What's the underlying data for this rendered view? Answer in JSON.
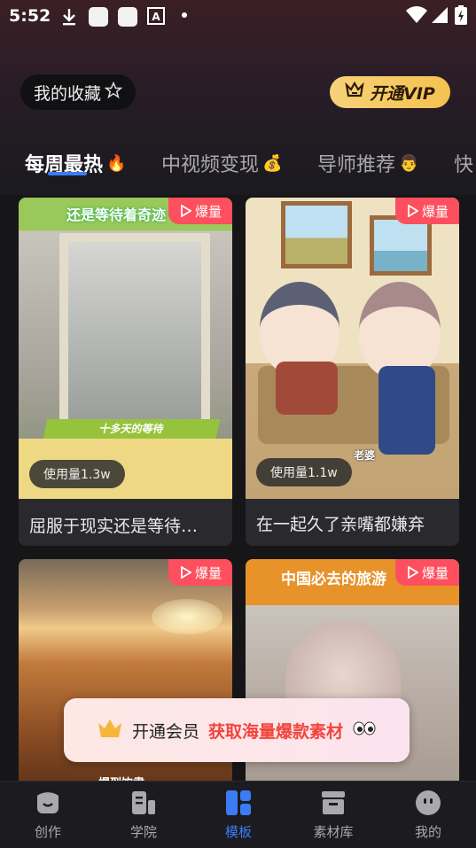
{
  "status_bar": {
    "time": "5:52",
    "icons": [
      "download-icon",
      "app-square-icon",
      "app-square-icon",
      "font-icon",
      "dot-icon",
      "wifi-icon",
      "signal-icon",
      "battery-icon"
    ]
  },
  "header": {
    "favorites_label": "我的收藏",
    "favorites_icon": "star-outline-icon",
    "vip_label": "开通VIP",
    "vip_icon": "crown-icon"
  },
  "tabs": [
    {
      "label": "每周最热",
      "emoji": "🔥",
      "active": true
    },
    {
      "label": "中视频变现",
      "emoji": "💰",
      "active": false
    },
    {
      "label": "导师推荐",
      "emoji": "👨",
      "active": false
    },
    {
      "label": "快",
      "emoji": "",
      "active": false
    }
  ],
  "cards": [
    {
      "title": "屈服于现实还是等待…",
      "usage": "使用量1.3w",
      "badge": "爆量",
      "overlay_top": "还是等待着奇迹",
      "overlay_bottom": "十多天的等待"
    },
    {
      "title": "在一起久了亲嘴都嫌弃",
      "usage": "使用量1.1w",
      "badge": "爆量",
      "overlay_bottom": "老婆"
    },
    {
      "title": "",
      "usage": "",
      "badge": "爆量",
      "overlay_bottom": "爆到饮肃"
    },
    {
      "title": "",
      "usage": "",
      "badge": "爆量",
      "overlay_top": "中国必去的旅游"
    }
  ],
  "promo": {
    "prefix": "开通会员",
    "highlight": "获取海量爆款素材",
    "icon": "crown-icon",
    "suffix_icon": "eyes-icon"
  },
  "nav": [
    {
      "label": "创作",
      "icon": "create-icon",
      "active": false
    },
    {
      "label": "学院",
      "icon": "academy-icon",
      "active": false
    },
    {
      "label": "模板",
      "icon": "template-icon",
      "active": true
    },
    {
      "label": "素材库",
      "icon": "store-icon",
      "active": false
    },
    {
      "label": "我的",
      "icon": "profile-icon",
      "active": false
    }
  ],
  "colors": {
    "accent": "#3b7cf6",
    "badge": "#fe4f5e",
    "vip_gold": "#f4c24f",
    "promo_highlight": "#f2443c"
  }
}
